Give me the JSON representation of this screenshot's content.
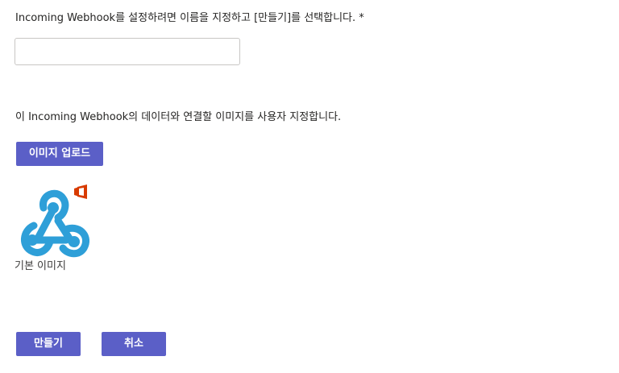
{
  "form": {
    "name_prompt": "Incoming Webhook를 설정하려면 이름을 지정하고 [만들기]를 선택합니다. *",
    "name_value": "",
    "image_prompt": "이 Incoming Webhook의 데이터와 연결할 이미지를 사용자 지정합니다.",
    "upload_button": "이미지 업로드",
    "image_caption": "기본 이미지",
    "image_icon": "webhook-icon",
    "badge_icon": "office-icon"
  },
  "actions": {
    "create_button": "만들기",
    "cancel_button": "취소"
  },
  "colors": {
    "accent": "#5b5fc7",
    "webhook_blue": "#2e9fd8",
    "office_red": "#d83b01"
  }
}
